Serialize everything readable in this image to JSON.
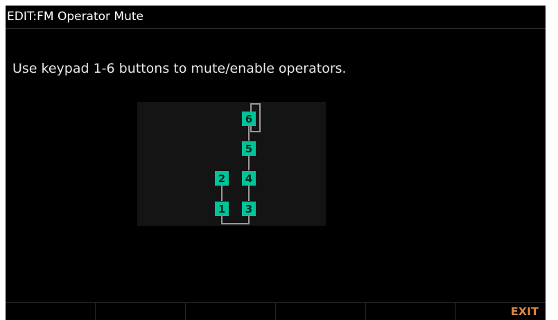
{
  "header": {
    "title": "EDIT:FM Operator Mute"
  },
  "main": {
    "instruction": "Use keypad 1-6 buttons to mute/enable operators."
  },
  "algorithm": {
    "operators": [
      {
        "label": "1",
        "state": "enabled"
      },
      {
        "label": "2",
        "state": "enabled"
      },
      {
        "label": "3",
        "state": "enabled"
      },
      {
        "label": "4",
        "state": "enabled"
      },
      {
        "label": "5",
        "state": "enabled"
      },
      {
        "label": "6",
        "state": "enabled"
      }
    ]
  },
  "softkeys": [
    {
      "label": ""
    },
    {
      "label": ""
    },
    {
      "label": ""
    },
    {
      "label": ""
    },
    {
      "label": ""
    },
    {
      "label": "EXIT"
    }
  ],
  "colors": {
    "background": "#000000",
    "operator_enabled": "#00c39a",
    "connector": "#9a9a9a",
    "softkey_text": "#d98a48"
  }
}
